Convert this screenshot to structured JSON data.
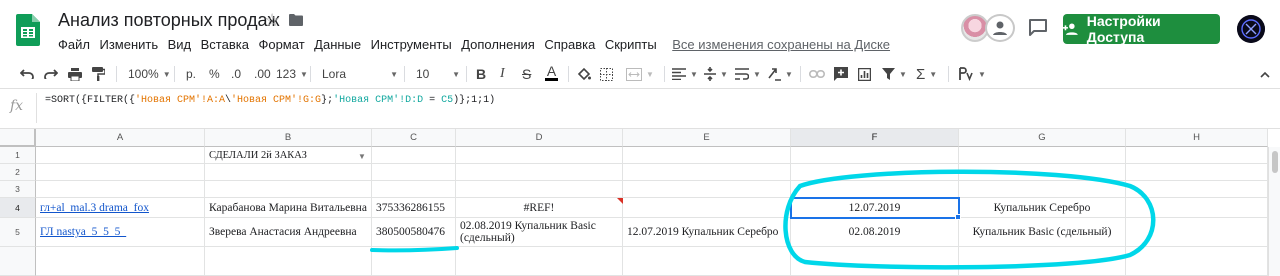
{
  "app": {
    "name": "Google Sheets",
    "brand_color": "#0f9d58",
    "share_color": "#1e8e3e",
    "selection_color": "#1a73e8",
    "annotation_color": "#00d7e9"
  },
  "header": {
    "title": "Анализ повторных продаж",
    "menu": [
      "Файл",
      "Изменить",
      "Вид",
      "Вставка",
      "Формат",
      "Данные",
      "Инструменты",
      "Дополнения",
      "Справка",
      "Скрипты"
    ],
    "save_status": "Все изменения сохранены на Диске",
    "share_label": "Настройки Доступа"
  },
  "toolbar": {
    "zoom": "100%",
    "currency": "р.",
    "percent": "%",
    "dec_decrease": ".0",
    "dec_increase": ".00",
    "more_formats": "123",
    "font": "Lora",
    "font_size": "10",
    "bold": "B",
    "italic": "I",
    "strike": "S",
    "text_color": "A",
    "functions": "Σ"
  },
  "formula_bar": {
    "fx": "fx",
    "parts": [
      "=SORT({FILTER({",
      "'Новая CPM'!A:A",
      "\\",
      "'Новая CPM'!G:G",
      "};",
      "'Новая CPM'!D:D",
      " = ",
      "C5",
      ")};1;1)"
    ]
  },
  "grid": {
    "columns": [
      "A",
      "B",
      "C",
      "D",
      "E",
      "F",
      "G",
      "H"
    ],
    "selected_column": "F",
    "rows": [
      "1",
      "2",
      "3",
      "4",
      "5"
    ],
    "selected_row": "4",
    "cells": {
      "B1": "СДЕЛАЛИ 2й ЗАКАЗ",
      "A4": "гл+al_mal.3 drama_fox",
      "B4": "Карабанова Марина Витальевна",
      "C4": "375336286155",
      "D4": "#REF!",
      "F4": "12.07.2019",
      "G4": "Купальник Серебро",
      "A5": "ГЛ nastya_5_5_5_",
      "B5": "Зверева Анастасия Андреевна",
      "C5": "380500580476",
      "D5": "02.08.2019 Купальник Basic (сдельный)",
      "E5": "12.07.2019 Купальник Серебро",
      "F5": "02.08.2019",
      "G5": "Купальник Basic (сдельный)"
    }
  }
}
